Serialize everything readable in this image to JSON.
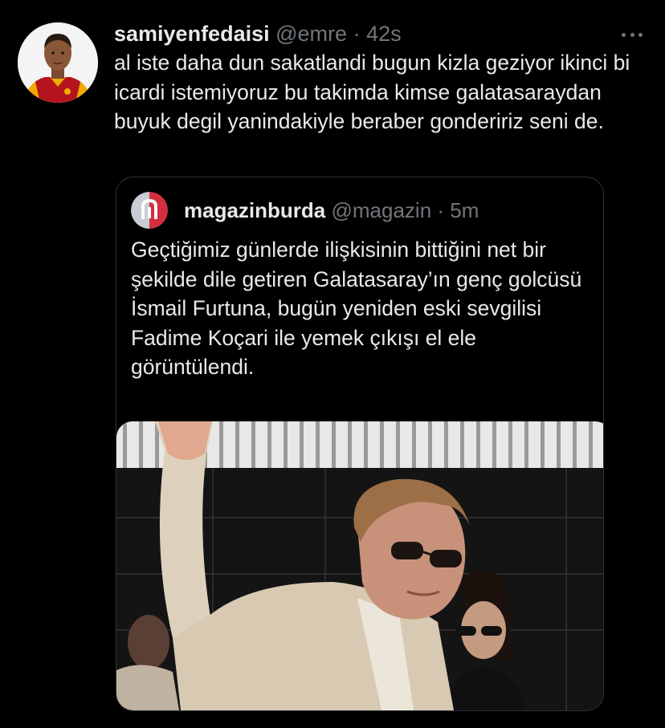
{
  "tweet": {
    "display_name": "samiyenfedaisi",
    "handle": "@emre",
    "separator": "·",
    "time": "42s",
    "text": "al iste daha dun sakatlandi bugun kizla geziyor ikinci bi icardi istemiyoruz bu takimda kimse galatasaraydan buyuk degil yanindakiyle beraber gondeririz seni de.",
    "more_icon": "more-horizontal-icon"
  },
  "quote": {
    "display_name": "magazinburda",
    "handle": "@magazin",
    "separator": "·",
    "time": "5m",
    "text": "Geçtiğimiz günlerde ilişkisinin bittiğini net bir şekilde dile getiren Galatasaray’ın genç golcüsü İsmail Furtuna, bugün yeniden eski sevgilisi Fadime Koçari ile yemek çıkışı el ele görüntülendi."
  },
  "colors": {
    "background": "#000000",
    "text_primary": "#e7e9ea",
    "text_secondary": "#71767b",
    "border": "#2f3336",
    "avatar_logo_red": "#d32f3f",
    "avatar_logo_blue": "#24304f",
    "jersey_red": "#b5141e",
    "jersey_yellow": "#f2a900"
  }
}
